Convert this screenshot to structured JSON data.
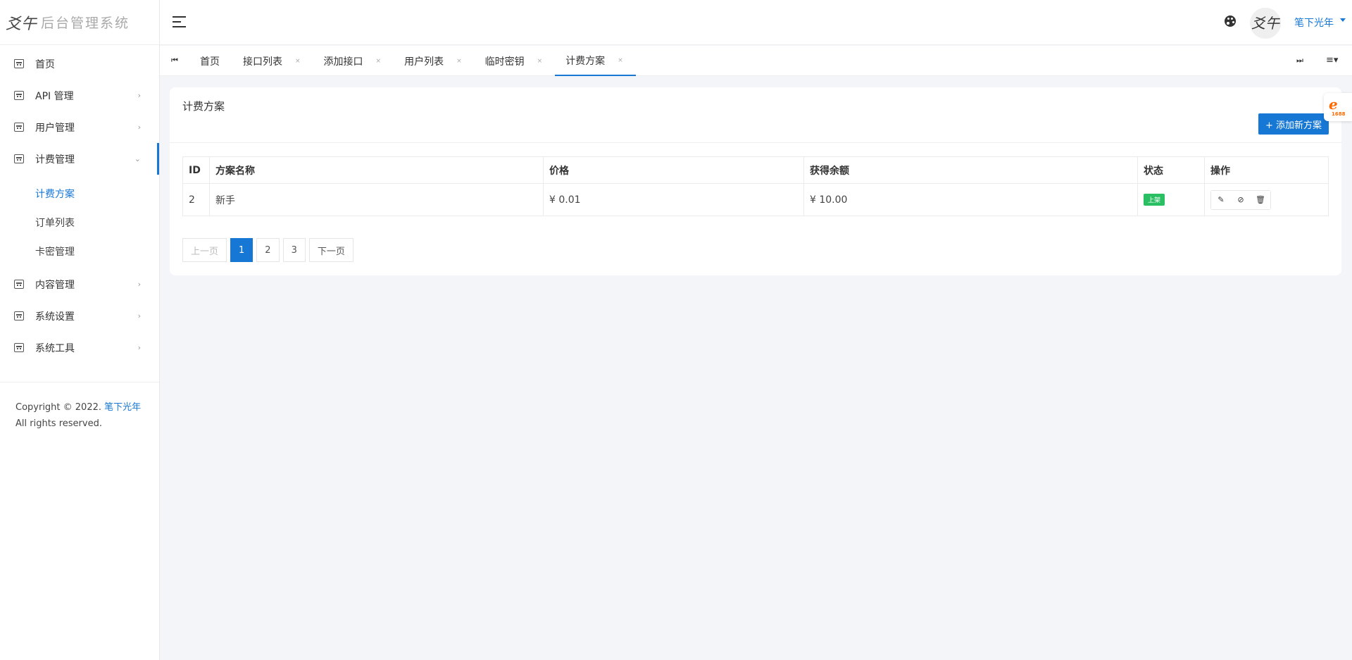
{
  "brand": {
    "logo": "爻午",
    "title": "后台管理系统"
  },
  "sidebar": {
    "items": [
      {
        "label": "首页",
        "icon": "home-icon",
        "arrow": ""
      },
      {
        "label": "API 管理",
        "icon": "calendar-icon",
        "arrow": "›"
      },
      {
        "label": "用户管理",
        "icon": "calendar-icon",
        "arrow": "›"
      },
      {
        "label": "计费管理",
        "icon": "calendar-icon",
        "arrow": "⌄"
      },
      {
        "label": "内容管理",
        "icon": "calendar-icon",
        "arrow": "›"
      },
      {
        "label": "系统设置",
        "icon": "calendar-icon",
        "arrow": "›"
      },
      {
        "label": "系统工具",
        "icon": "calendar-icon",
        "arrow": "›"
      }
    ],
    "submenu": [
      "计费方案",
      "订单列表",
      "卡密管理"
    ],
    "footer": {
      "prefix": "Copyright © 2022.",
      "link": "笔下光年",
      "suffix": "All rights reserved."
    }
  },
  "header": {
    "avatar_text": "爻午",
    "user_name": "笔下光年",
    "accent": "#1677d4"
  },
  "tabs": {
    "nav_left": "⏮",
    "nav_right": "⏭",
    "menu": "≡▾",
    "items": [
      {
        "label": "首页",
        "close": ""
      },
      {
        "label": "接口列表",
        "close": "×"
      },
      {
        "label": "添加接口",
        "close": "×"
      },
      {
        "label": "用户列表",
        "close": "×"
      },
      {
        "label": "临时密钥",
        "close": "×"
      },
      {
        "label": "计费方案",
        "close": "×"
      }
    ]
  },
  "card": {
    "title": "计费方案",
    "add_button": "+ 添加新方案",
    "table": {
      "headers": [
        "ID",
        "方案名称",
        "价格",
        "获得余额",
        "状态",
        "操作"
      ],
      "rows": [
        {
          "id": "2",
          "name": "新手",
          "price": "¥ 0.01",
          "balance": "¥ 10.00",
          "status": "上架",
          "status_color": "#2bbf63"
        }
      ],
      "ops": {
        "edit": "✎",
        "hide": "⊘",
        "delete": "🗑"
      }
    },
    "pagination": {
      "prev": "上一页",
      "pages": [
        "1",
        "2",
        "3"
      ],
      "next": "下一页",
      "current": "1"
    }
  },
  "float_badge": {
    "logo": "e",
    "text": "1688"
  }
}
